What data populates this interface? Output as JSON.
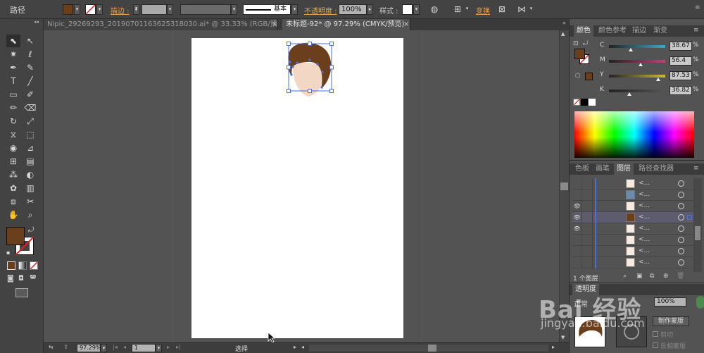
{
  "control_bar": {
    "object_label": "路径",
    "fill_color": "#6b3f1c",
    "stroke_label": "描边 :",
    "stroke_profile": "基本",
    "opacity_label": "不透明度 :",
    "opacity_value": "100%",
    "style_label": "样式 :",
    "transform_label": "变换"
  },
  "tabs": [
    {
      "label": "Nipic_29269293_20190701163625318030.ai* @ 33.33% (RGB/预览)",
      "close": "×"
    },
    {
      "label": "未标题-92* @ 97.29% (CMYK/预览)",
      "close": "×"
    }
  ],
  "toolbar": {
    "fill_color": "#6b3f1c",
    "stroke_color": "#ffffff"
  },
  "color_panel": {
    "tabs": [
      "颜色",
      "颜色参考",
      "描边",
      "渐变"
    ],
    "channels": [
      {
        "name": "C",
        "value": "38.67",
        "track": "#3fa7c8",
        "pos": 0.387
      },
      {
        "name": "M",
        "value": "56.4",
        "track": "#c43d7a",
        "pos": 0.564
      },
      {
        "name": "Y",
        "value": "87.53",
        "track": "#c9b93a",
        "pos": 0.875
      },
      {
        "name": "K",
        "value": "36.82",
        "track": "#555555",
        "pos": 0.368
      }
    ]
  },
  "layers_panel": {
    "tabs": [
      "色板",
      "画笔",
      "图层",
      "路径查找器"
    ],
    "rows_visible": [
      false,
      false,
      true,
      true,
      true,
      false,
      false,
      false
    ],
    "rows_selected": [
      false,
      false,
      false,
      true,
      false,
      false,
      false,
      false
    ],
    "layer_name": "<...",
    "layer_count": "1 个图层"
  },
  "transparency_panel": {
    "title": "透明度",
    "mode": "正常",
    "opacity": "100%",
    "make_mask_button": "制作蒙版",
    "clip_label": "剪切",
    "invert_label": "反相蒙版"
  },
  "status_bar": {
    "zoom": "97.29%",
    "page": "1",
    "tool": "选择"
  },
  "watermark": {
    "brand": "Bai 经验",
    "url": "jingyan.baidu.com"
  },
  "colors": {
    "hair": "#6b3f1c",
    "skin": "#f2d8c4",
    "selection": "#4a6fd8"
  }
}
